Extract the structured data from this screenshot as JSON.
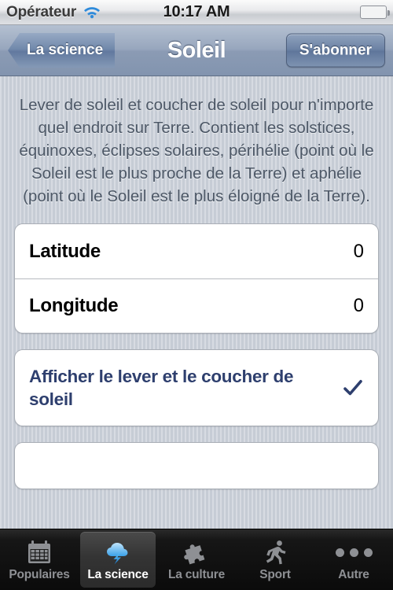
{
  "status_bar": {
    "carrier": "Opérateur",
    "time": "10:17 AM",
    "wifi_icon": "wifi-icon",
    "battery_icon": "battery-icon",
    "battery_level": "full",
    "accent": "#2e8bdb"
  },
  "nav_bar": {
    "back_label": "La science",
    "title": "Soleil",
    "action_label": "S'abonner"
  },
  "content": {
    "description": "Lever de soleil et coucher de soleil pour n'importe quel endroit sur Terre. Contient les solstices, équinoxes, éclipses solaires, périhélie (point où le Soleil est le plus proche de la Terre) et aphélie (point où le Soleil est le plus éloigné de la Terre).",
    "fields": [
      {
        "label": "Latitude",
        "value": "0"
      },
      {
        "label": "Longitude",
        "value": "0"
      }
    ],
    "action": {
      "label": "Afficher le lever et le coucher de soleil",
      "checked": true,
      "check_icon": "check-icon",
      "color": "#2e3f6e"
    }
  },
  "tab_bar": {
    "items": [
      {
        "label": "Populaires",
        "icon": "calendar-icon",
        "active": false
      },
      {
        "label": "La science",
        "icon": "cloud-lightning-icon",
        "active": true
      },
      {
        "label": "La culture",
        "icon": "puzzle-piece-icon",
        "active": false
      },
      {
        "label": "Sport",
        "icon": "running-person-icon",
        "active": false
      },
      {
        "label": "Autre",
        "icon": "ellipsis-icon",
        "active": false
      }
    ]
  }
}
